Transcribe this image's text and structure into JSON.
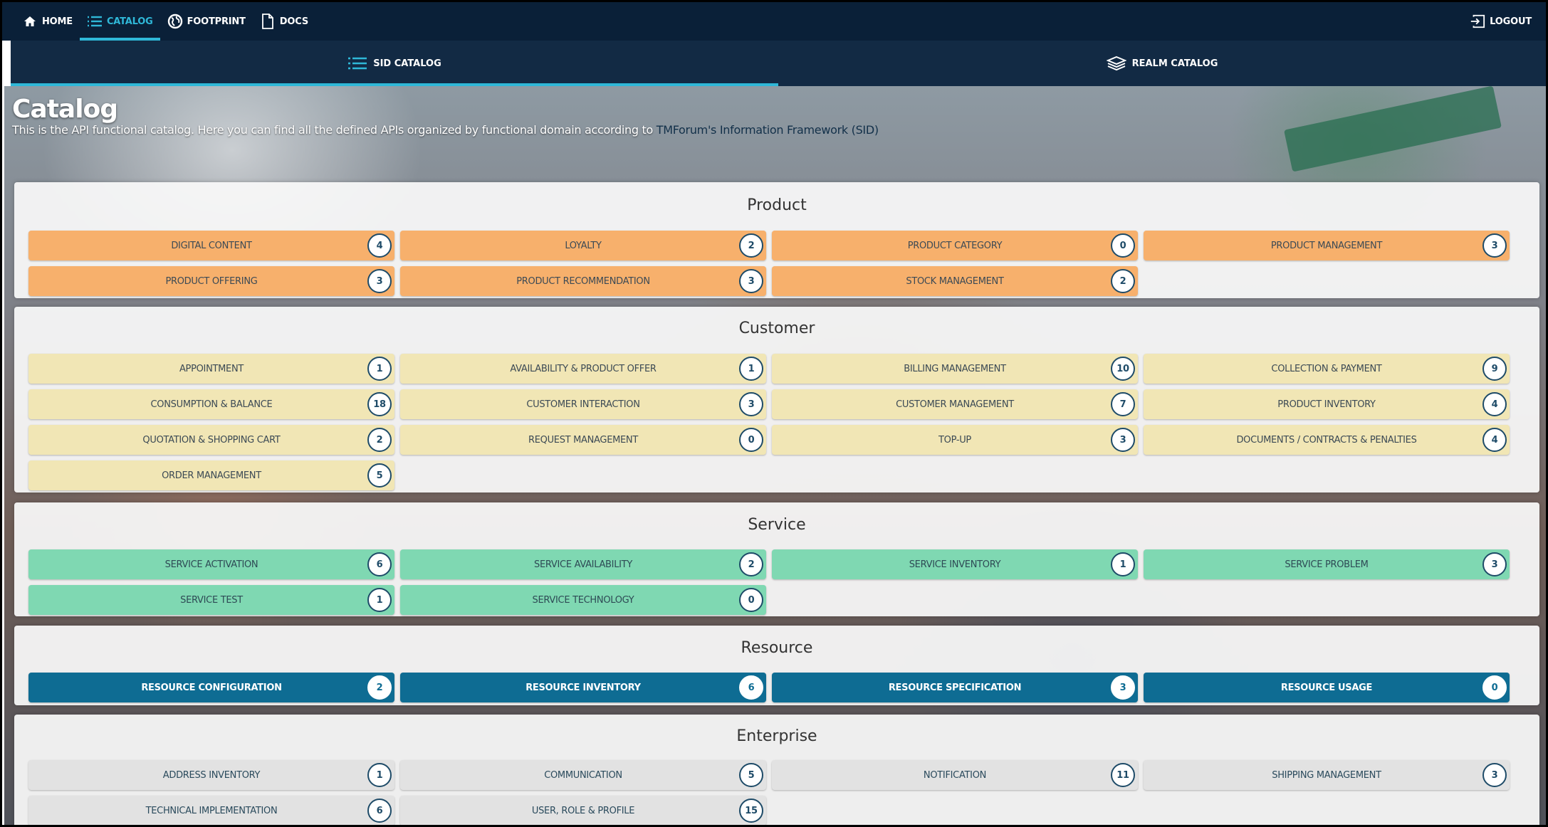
{
  "nav": {
    "home": "HOME",
    "catalog": "CATALOG",
    "footprint": "FOOTPRINT",
    "docs": "DOCS",
    "logout": "LOGOUT"
  },
  "tabs": {
    "sid": "SID CATALOG",
    "realm": "REALM CATALOG"
  },
  "page": {
    "title": "Catalog",
    "subtitle": "This is the API functional catalog. Here you can find all the defined APIs organized by functional domain according to ",
    "subtitle_link": "TMForum's Information Framework (SID)"
  },
  "sections": {
    "product": {
      "title": "Product",
      "items": [
        {
          "label": "DIGITAL CONTENT",
          "count": "4"
        },
        {
          "label": "LOYALTY",
          "count": "2"
        },
        {
          "label": "PRODUCT CATEGORY",
          "count": "0"
        },
        {
          "label": "PRODUCT MANAGEMENT",
          "count": "3"
        },
        {
          "label": "PRODUCT OFFERING",
          "count": "3"
        },
        {
          "label": "PRODUCT RECOMMENDATION",
          "count": "3"
        },
        {
          "label": "STOCK MANAGEMENT",
          "count": "2"
        }
      ]
    },
    "customer": {
      "title": "Customer",
      "items": [
        {
          "label": "APPOINTMENT",
          "count": "1"
        },
        {
          "label": "AVAILABILITY & PRODUCT OFFER",
          "count": "1"
        },
        {
          "label": "BILLING MANAGEMENT",
          "count": "10"
        },
        {
          "label": "COLLECTION & PAYMENT",
          "count": "9"
        },
        {
          "label": "CONSUMPTION & BALANCE",
          "count": "18"
        },
        {
          "label": "CUSTOMER INTERACTION",
          "count": "3"
        },
        {
          "label": "CUSTOMER MANAGEMENT",
          "count": "7"
        },
        {
          "label": "PRODUCT INVENTORY",
          "count": "4"
        },
        {
          "label": "QUOTATION & SHOPPING CART",
          "count": "2"
        },
        {
          "label": "REQUEST MANAGEMENT",
          "count": "0"
        },
        {
          "label": "TOP-UP",
          "count": "3"
        },
        {
          "label": "DOCUMENTS / CONTRACTS & PENALTIES",
          "count": "4"
        },
        {
          "label": "ORDER MANAGEMENT",
          "count": "5"
        }
      ]
    },
    "service": {
      "title": "Service",
      "items": [
        {
          "label": "SERVICE ACTIVATION",
          "count": "6"
        },
        {
          "label": "SERVICE AVAILABILITY",
          "count": "2"
        },
        {
          "label": "SERVICE INVENTORY",
          "count": "1"
        },
        {
          "label": "SERVICE PROBLEM",
          "count": "3"
        },
        {
          "label": "SERVICE TEST",
          "count": "1"
        },
        {
          "label": "SERVICE TECHNOLOGY",
          "count": "0"
        }
      ]
    },
    "resource": {
      "title": "Resource",
      "items": [
        {
          "label": "RESOURCE CONFIGURATION",
          "count": "2"
        },
        {
          "label": "RESOURCE INVENTORY",
          "count": "6"
        },
        {
          "label": "RESOURCE SPECIFICATION",
          "count": "3"
        },
        {
          "label": "RESOURCE USAGE",
          "count": "0"
        }
      ]
    },
    "enterprise": {
      "title": "Enterprise",
      "items": [
        {
          "label": "ADDRESS INVENTORY",
          "count": "1"
        },
        {
          "label": "COMMUNICATION",
          "count": "5"
        },
        {
          "label": "NOTIFICATION",
          "count": "11"
        },
        {
          "label": "SHIPPING MANAGEMENT",
          "count": "3"
        },
        {
          "label": "TECHNICAL IMPLEMENTATION",
          "count": "6"
        },
        {
          "label": "USER, ROLE & PROFILE",
          "count": "15"
        }
      ]
    }
  },
  "colors": {
    "nav_bg": "#0a2038",
    "accent": "#2fb8d8",
    "product": "#f7b06c",
    "customer": "#f1e6b5",
    "service": "#7fd8b2",
    "resource": "#0e6c93",
    "enterprise": "#e2e2e2"
  }
}
